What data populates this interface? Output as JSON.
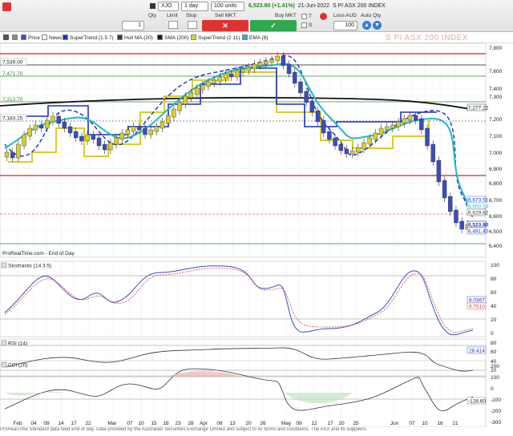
{
  "toolbar": {
    "symbol": "XJO",
    "interval": "1 day",
    "units": "100 units",
    "quote_price": "6,523.80",
    "quote_change": "(+1.41%)",
    "quote_date": "21-Jun-2022",
    "quote_name": "S P/ ASX 200 INDEX",
    "qty_label": "Qty",
    "qty_value": "1",
    "limit_label": "Limit",
    "stop_label": "Stop",
    "sell_label": "Sell MKT",
    "buy_label": "Buy MKT",
    "t_label": "T",
    "s_label": "S",
    "loss_label": "Loss AUD",
    "loss_value": "100",
    "auto_qty_label": "Auto Qty",
    "sell_color": "#e03131",
    "buy_color": "#2fa84f"
  },
  "legend": {
    "items": [
      {
        "label": "Price",
        "color": "#3b4cc0"
      },
      {
        "label": "News",
        "color": "#ffffff"
      },
      {
        "label": "SuperTrend (1.5 7)",
        "color": "#1d2fc4"
      },
      {
        "label": "Hull MA (20)",
        "color": "#3a3a3a"
      },
      {
        "label": "SMA (200)",
        "color": "#1a1a1a"
      },
      {
        "label": "SuperTrend (2 11)",
        "color": "#d8cf2a"
      },
      {
        "label": "EMA (8)",
        "color": "#22b8c8"
      }
    ],
    "watermark": "S P/ ASX 200 INDEX"
  },
  "price_panel": {
    "y_ticks": [
      "7,800",
      "7,600",
      "7,400",
      "7,300",
      "7,200",
      "7,100",
      "7,000",
      "6,900",
      "6,800",
      "6,700",
      "6,600",
      "6,500",
      "6,400"
    ],
    "left_labels": [
      {
        "text": "7,539.00",
        "color": "#222222"
      },
      {
        "text": "7,471.70",
        "color": "#2c8a2c"
      },
      {
        "text": "7,313.70",
        "color": "#2c8a2c"
      },
      {
        "text": "7,183.15",
        "color": "#222222"
      }
    ],
    "right_labels": [
      {
        "text": "7,277.22",
        "color": "#1a1a1a"
      },
      {
        "text": "6,673.51",
        "color": "#1d2fc4"
      },
      {
        "text": "6,650.14",
        "color": "#22b8c8"
      },
      {
        "text": "6,629.82",
        "color": "#3a3a3a"
      },
      {
        "text": "6,523.80",
        "color": "#1d2fc4"
      },
      {
        "text": "6,491.40",
        "color": "#1d2fc4"
      }
    ],
    "source": "ProRealTime.com - End of Day"
  },
  "stochastic": {
    "title": "Stochastic (14 3 5)",
    "y_ticks": [
      "100",
      "80",
      "60",
      "40",
      "20",
      "0"
    ],
    "right_labels": [
      "8.0367",
      "6.7510"
    ]
  },
  "rsi": {
    "title": "RSI (14)",
    "y_ticks": [
      "80",
      "60",
      "40",
      "20"
    ],
    "right_labels": [
      "28.414"
    ]
  },
  "cci": {
    "title": "CCI (20)",
    "y_ticks": [
      "200",
      "100",
      "0",
      "-100",
      "-200",
      "-300"
    ],
    "right_labels": [
      "-128.60"
    ]
  },
  "x_axis": {
    "labels": [
      "Feb",
      "04",
      "09",
      "14",
      "17",
      "22",
      "Mar",
      "07",
      "10",
      "15",
      "18",
      "23",
      "28",
      "Apr",
      "08",
      "13",
      "20",
      "26",
      "May",
      "09",
      "12",
      "17",
      "20",
      "25",
      "Jun",
      "07",
      "10",
      "16",
      "21"
    ]
  },
  "footer": "ProRealTime Standard data feed end of day. Data provided by the Australian Securities Exchange Limited and subject to its terms and conditions. The ASX and its suppliers."
}
